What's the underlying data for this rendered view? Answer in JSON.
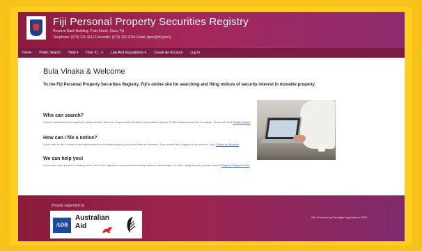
{
  "header": {
    "title": "Fiji Personal Property Securities Registry",
    "address": "Reserve Bank Building, Pratt Street, Suva, Fiji",
    "contact": "Telephone: (679) 331 3611   Facsimile: (679) 330 2094   Email: ppsr@rbf.gov.fj"
  },
  "nav": {
    "items": [
      "Home",
      "Public Search",
      "Help ▾",
      "How To... ▾",
      "Law And Regulations ▾",
      "Create An Account",
      "Log In"
    ]
  },
  "main": {
    "welcome": "Bula Vinaka & Welcome",
    "intro": "To the Fiji Personal Property Securities Registry, Fiji's online site for searching and filing notices of security interest in movable property",
    "sections": [
      {
        "heading": "Who can search?",
        "text": "Anyone can search the registry to verify whether there are any security interests on movable property. Public searches are free of charge. To access, click",
        "link": "Public Search"
      },
      {
        "heading": "How can I file a notice?",
        "text": "If you wish to file a notice of security interest on movable property, you must have an account. If you would like to apply for an account, click",
        "link": "Create an Account"
      },
      {
        "heading": "We can help you!",
        "text": "If you have any questions relating to the use of the registry or encounter technical problems connecting to or while using this site, please contact",
        "link": "Registry Support Team"
      }
    ]
  },
  "footer": {
    "supported_by": "Proudly supported by",
    "partners": {
      "adb": "ADB",
      "aus_line1": "Australian",
      "aus_line2": "Aid"
    },
    "developer": "Site Powered by Paradigm Applications 2016"
  },
  "colors": {
    "header": "#8e1b3c",
    "nav": "#7a1b44",
    "frame": "#ffcf1f",
    "link": "#3355aa"
  }
}
